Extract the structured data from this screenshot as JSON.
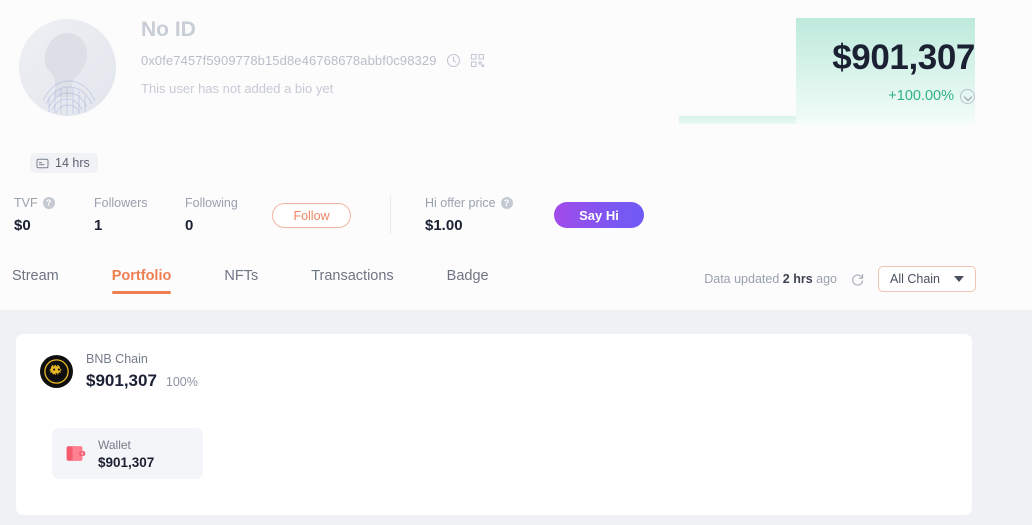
{
  "profile": {
    "display_name": "No ID",
    "address": "0x0fe7457f5909778b15d8e46768678abbf0c98329",
    "bio": "This user has not added a bio yet",
    "copy_icon": "copy-icon",
    "qr_icon": "qr-code-icon",
    "avatar_alt": "default-avatar"
  },
  "time_badge": {
    "label": "14 hrs",
    "icon": "card-id-icon"
  },
  "balance": {
    "amount": "$901,307",
    "change": "+100.00%",
    "change_color": "#2fb383",
    "expand_icon": "chevron-down-circle-icon"
  },
  "stats": [
    {
      "label": "TVF",
      "value": "$0",
      "has_help": true
    },
    {
      "label": "Followers",
      "value": "1",
      "has_help": false
    },
    {
      "label": "Following",
      "value": "0",
      "has_help": false
    }
  ],
  "hi_offer": {
    "label": "Hi offer price",
    "value": "$1.00",
    "help": "?"
  },
  "actions": {
    "follow_label": "Follow",
    "follow_color": "#ec8864",
    "say_hi_label": "Say Hi",
    "say_hi_color": "#8155f0"
  },
  "help_glyph": "?",
  "tabs": [
    {
      "label": "Stream",
      "active": false
    },
    {
      "label": "Portfolio",
      "active": true
    },
    {
      "label": "NFTs",
      "active": false
    },
    {
      "label": "Transactions",
      "active": false
    },
    {
      "label": "Badge",
      "active": false
    }
  ],
  "tab_accent": "#ef7f50",
  "toolbar": {
    "updated_prefix": "Data updated",
    "updated_value": "2 hrs",
    "updated_suffix": "ago",
    "refresh_icon": "refresh-icon",
    "chain_selected": "All Chain"
  },
  "portfolio": {
    "chain": {
      "name": "BNB Chain",
      "amount": "$901,307",
      "percent": "100%",
      "logo": "bnb-chain-logo"
    },
    "wallet": {
      "label": "Wallet",
      "amount": "$901,307",
      "icon": "wallet-icon"
    }
  }
}
